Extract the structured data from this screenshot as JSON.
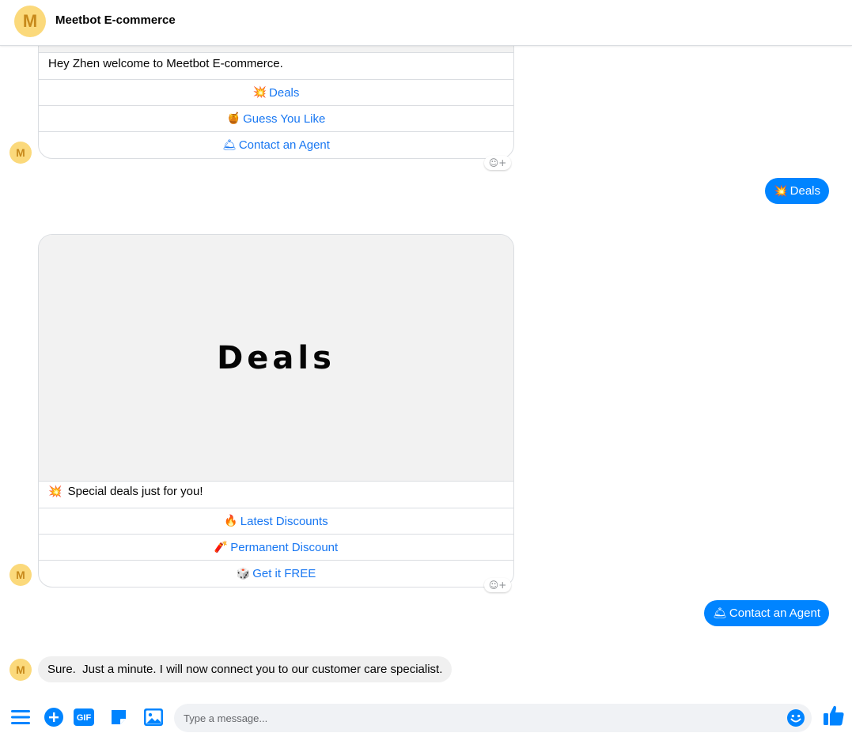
{
  "header": {
    "avatar_letter": "M",
    "title": "Meetbot E-commerce"
  },
  "messages": {
    "card1": {
      "avatar_letter": "M",
      "text": "Hey Zhen welcome to Meetbot E-commerce.",
      "buttons": [
        {
          "emoji": "💥",
          "label": "Deals"
        },
        {
          "emoji": "🍯",
          "label": "Guess You Like"
        },
        {
          "emoji": "🛎",
          "label": "Contact an Agent"
        }
      ]
    },
    "out1": {
      "emoji": "💥",
      "label": "Deals"
    },
    "card2": {
      "avatar_letter": "M",
      "hero_text": "Deals",
      "emoji": "💥",
      "text": "Special deals just for you!",
      "buttons": [
        {
          "emoji": "🔥",
          "label": "Latest Discounts"
        },
        {
          "emoji": "🧨",
          "label": "Permanent Discount"
        },
        {
          "emoji": "🎲",
          "label": "Get it FREE"
        }
      ]
    },
    "out2": {
      "emoji": "🛎",
      "label": "Contact an Agent"
    },
    "in1": {
      "avatar_letter": "M",
      "text": "Sure.  Just a minute. I will now connect you to our customer care specialist."
    }
  },
  "composer": {
    "placeholder": "Type a message...",
    "gif_label": "GIF"
  },
  "icons": [
    "menu-icon",
    "plus-icon",
    "gif-icon",
    "sticker-icon",
    "image-icon",
    "emoji-icon",
    "thumbs-up-icon",
    "reaction-icon"
  ],
  "colors": {
    "accent": "#0084ff",
    "link": "#1877f2",
    "avatar_bg": "#fbd97b",
    "avatar_fg": "#c7891b"
  }
}
